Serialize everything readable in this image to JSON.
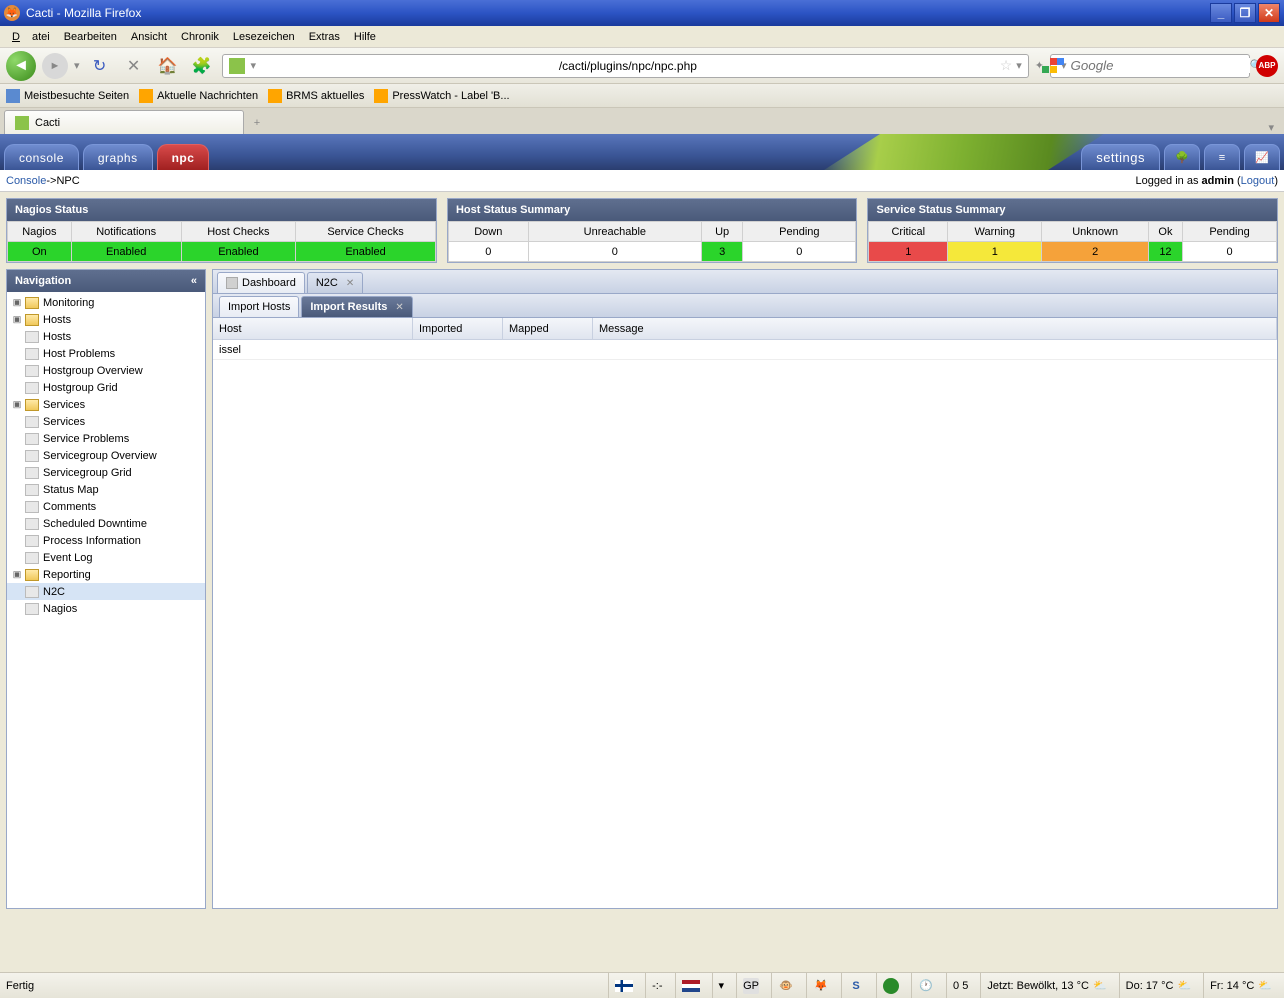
{
  "window": {
    "title": "Cacti - Mozilla Firefox"
  },
  "menu": {
    "file": "Datei",
    "edit": "Bearbeiten",
    "view": "Ansicht",
    "history": "Chronik",
    "bookmarks": "Lesezeichen",
    "extras": "Extras",
    "help": "Hilfe"
  },
  "toolbar": {
    "url": "/cacti/plugins/npc/npc.php",
    "search_placeholder": "Google"
  },
  "bookmarks": [
    "Meistbesuchte Seiten",
    "Aktuelle Nachrichten",
    "BRMS aktuelles",
    "PressWatch - Label 'B..."
  ],
  "browser_tab": "Cacti",
  "apptabs": {
    "console": "console",
    "graphs": "graphs",
    "npc": "npc",
    "settings": "settings"
  },
  "crumb": {
    "a": "Console",
    "sep": " -> ",
    "b": "NPC",
    "logged": "Logged in as ",
    "user": "admin",
    "logout": "Logout"
  },
  "nagios": {
    "title": "Nagios Status",
    "cols": [
      "Nagios",
      "Notifications",
      "Host Checks",
      "Service Checks"
    ],
    "vals": [
      "On",
      "Enabled",
      "Enabled",
      "Enabled"
    ]
  },
  "host": {
    "title": "Host Status Summary",
    "cols": [
      "Down",
      "Unreachable",
      "Up",
      "Pending"
    ],
    "vals": [
      "0",
      "0",
      "3",
      "0"
    ]
  },
  "service": {
    "title": "Service Status Summary",
    "cols": [
      "Critical",
      "Warning",
      "Unknown",
      "Ok",
      "Pending"
    ],
    "vals": [
      "1",
      "1",
      "2",
      "12",
      "0"
    ]
  },
  "nav": {
    "title": "Navigation",
    "monitoring": "Monitoring",
    "hosts_folder": "Hosts",
    "hosts": "Hosts",
    "host_problems": "Host Problems",
    "hostgroup_overview": "Hostgroup Overview",
    "hostgroup_grid": "Hostgroup Grid",
    "services_folder": "Services",
    "services": "Services",
    "service_problems": "Service Problems",
    "servicegroup_overview": "Servicegroup Overview",
    "servicegroup_grid": "Servicegroup Grid",
    "status_map": "Status Map",
    "comments": "Comments",
    "scheduled_downtime": "Scheduled Downtime",
    "process_info": "Process Information",
    "event_log": "Event Log",
    "reporting": "Reporting",
    "n2c": "N2C",
    "nagios": "Nagios"
  },
  "content": {
    "tab_dashboard": "Dashboard",
    "tab_n2c": "N2C",
    "subtab_import_hosts": "Import Hosts",
    "subtab_import_results": "Import Results",
    "col_host": "Host",
    "col_imported": "Imported",
    "col_mapped": "Mapped",
    "col_message": "Message",
    "rows": [
      {
        "host": "issel",
        "imported": "",
        "mapped": "",
        "message": ""
      }
    ]
  },
  "status": {
    "ready": "Fertig",
    "weather_now": "Jetzt: Bewölkt, 13 °C",
    "weather_do": "Do: 17 °C",
    "weather_fr": "Fr: 14 °C",
    "digits": "0 5"
  }
}
